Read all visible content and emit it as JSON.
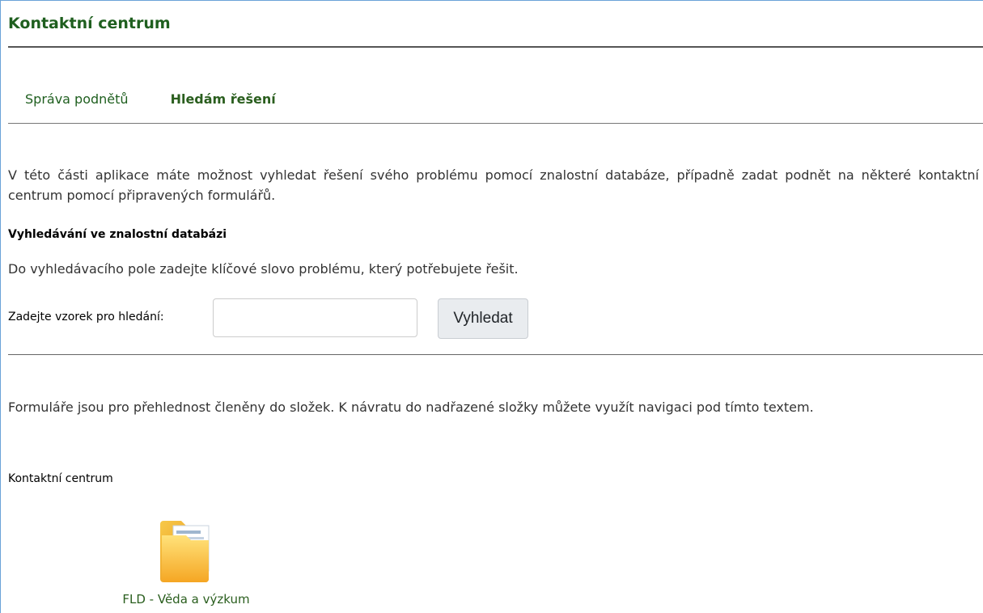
{
  "header": {
    "title": "Kontaktní centrum"
  },
  "nav": {
    "tabs": [
      {
        "label": "Správa podnětů",
        "active": false
      },
      {
        "label": "Hledám řešení",
        "active": true
      }
    ]
  },
  "intro": {
    "text": "V této části aplikace máte možnost vyhledat řešení svého problému pomocí znalostní databáze, případně zadat podnět na některé kontaktní centrum pomocí připravených formulářů."
  },
  "search": {
    "heading": "Vyhledávání ve znalostní databázi",
    "description": "Do vyhledávacího pole zadejte klíčové slovo problému, který potřebujete řešit.",
    "label": "Zadejte vzorek pro hledání:",
    "value": "",
    "button_label": "Vyhledat"
  },
  "forms": {
    "text": "Formuláře jsou pro přehlednost členěny do složek. K návratu do nadřazené složky můžete využít navigaci pod tímto textem.",
    "breadcrumb": "Kontaktní centrum",
    "folders": [
      {
        "label": "FLD - Věda a výzkum",
        "icon": "folder-icon"
      }
    ]
  },
  "colors": {
    "accent": "#1f5f1f",
    "frame": "#6aa3d8"
  }
}
